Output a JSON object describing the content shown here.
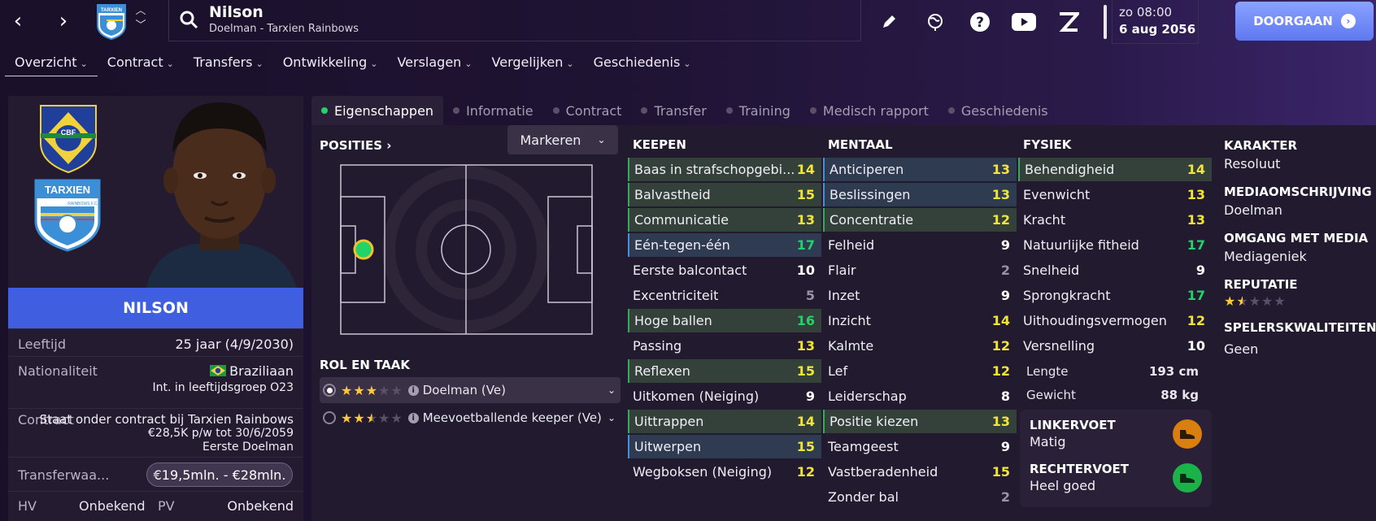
{
  "header": {
    "player_name": "Nilson",
    "player_sub": "Doelman - Tarxien Rainbows",
    "date_line1": "zo 08:00",
    "date_line2": "6 aug 2056",
    "continue_label": "DOORGAAN",
    "club_badge_text": "TARXIEN"
  },
  "menu": [
    {
      "label": "Overzicht"
    },
    {
      "label": "Contract"
    },
    {
      "label": "Transfers"
    },
    {
      "label": "Ontwikkeling"
    },
    {
      "label": "Verslagen"
    },
    {
      "label": "Vergelijken"
    },
    {
      "label": "Geschiedenis"
    }
  ],
  "left": {
    "nation_badge_text": "CBF",
    "club_badge_text": "TARXIEN",
    "club_badge_sub": "RAINBOWS F.C.",
    "name": "NILSON",
    "age_label": "Leeftijd",
    "age_value": "25 jaar (4/9/2030)",
    "nat_label": "Nationaliteit",
    "nat_value": "Braziliaan",
    "nat_sub": "Int. in leeftijdsgroep O23",
    "contract_label": "Contract",
    "contract_line1": "Staat onder contract bij Tarxien Rainbows",
    "contract_line2": "€28,5K p/w tot 30/6/2059",
    "contract_line3": "Eerste Doelman",
    "transfer_label": "Transferwaa...",
    "transfer_value": "€19,5mln. - €28mln.",
    "hv_label": "HV",
    "hv_value": "Onbekend",
    "pv_label": "PV",
    "pv_value": "Onbekend"
  },
  "tabs": [
    {
      "label": "Eigenschappen"
    },
    {
      "label": "Informatie"
    },
    {
      "label": "Contract"
    },
    {
      "label": "Transfer"
    },
    {
      "label": "Training"
    },
    {
      "label": "Medisch rapport"
    },
    {
      "label": "Geschiedenis"
    }
  ],
  "positions": {
    "title": "POSITIES",
    "markeren": "Markeren",
    "role_title": "ROL EN TAAK",
    "roles": [
      {
        "label": "Doelman (Ve)",
        "stars": 3
      },
      {
        "label": "Meevoetballende keeper (Ve)",
        "stars": 2.5
      }
    ]
  },
  "keepen": {
    "title": "KEEPEN",
    "attrs": [
      {
        "name": "Baas in strafschopgebi...",
        "value": "14"
      },
      {
        "name": "Balvastheid",
        "value": "15"
      },
      {
        "name": "Communicatie",
        "value": "13"
      },
      {
        "name": "Eén-tegen-één",
        "value": "17"
      },
      {
        "name": "Eerste balcontact",
        "value": "10"
      },
      {
        "name": "Excentriciteit",
        "value": "5"
      },
      {
        "name": "Hoge ballen",
        "value": "16"
      },
      {
        "name": "Passing",
        "value": "13"
      },
      {
        "name": "Reflexen",
        "value": "15"
      },
      {
        "name": "Uitkomen (Neiging)",
        "value": "9"
      },
      {
        "name": "Uittrappen",
        "value": "14"
      },
      {
        "name": "Uitwerpen",
        "value": "15"
      },
      {
        "name": "Wegboksen (Neiging)",
        "value": "12"
      }
    ]
  },
  "mentaal": {
    "title": "MENTAAL",
    "attrs": [
      {
        "name": "Anticiperen",
        "value": "13"
      },
      {
        "name": "Beslissingen",
        "value": "13"
      },
      {
        "name": "Concentratie",
        "value": "12"
      },
      {
        "name": "Felheid",
        "value": "9"
      },
      {
        "name": "Flair",
        "value": "2"
      },
      {
        "name": "Inzet",
        "value": "9"
      },
      {
        "name": "Inzicht",
        "value": "14"
      },
      {
        "name": "Kalmte",
        "value": "12"
      },
      {
        "name": "Lef",
        "value": "12"
      },
      {
        "name": "Leiderschap",
        "value": "8"
      },
      {
        "name": "Positie kiezen",
        "value": "13"
      },
      {
        "name": "Teamgeest",
        "value": "9"
      },
      {
        "name": "Vastberadenheid",
        "value": "15"
      },
      {
        "name": "Zonder bal",
        "value": "2"
      }
    ]
  },
  "fysiek": {
    "title": "FYSIEK",
    "attrs": [
      {
        "name": "Behendigheid",
        "value": "14"
      },
      {
        "name": "Evenwicht",
        "value": "13"
      },
      {
        "name": "Kracht",
        "value": "13"
      },
      {
        "name": "Natuurlijke fitheid",
        "value": "17"
      },
      {
        "name": "Snelheid",
        "value": "9"
      },
      {
        "name": "Sprongkracht",
        "value": "17"
      },
      {
        "name": "Uithoudingsvermogen",
        "value": "12"
      },
      {
        "name": "Versnelling",
        "value": "10"
      }
    ],
    "length_label": "Lengte",
    "length_value": "193 cm",
    "weight_label": "Gewicht",
    "weight_value": "88 kg",
    "left_foot_label": "LINKERVOET",
    "left_foot_value": "Matig",
    "right_foot_label": "RECHTERVOET",
    "right_foot_value": "Heel goed"
  },
  "side": {
    "karakter_label": "KARAKTER",
    "karakter_value": "Resoluut",
    "media_label": "MEDIAOMSCHRIJVING",
    "media_value": "Doelman",
    "omgang_label": "OMGANG MET MEDIA",
    "omgang_value": "Mediageniek",
    "reputatie_label": "REPUTATIE",
    "reputatie_stars": 1.5,
    "kwal_label": "SPELERSKWALITEITEN",
    "kwal_value": "Geen"
  },
  "colors": {
    "accent": "#3f5fe0",
    "green_value": "#22d36a",
    "yellow_value": "#f2e53a",
    "left_foot_icon": "#d97f10",
    "right_foot_icon": "#1bb24a"
  }
}
